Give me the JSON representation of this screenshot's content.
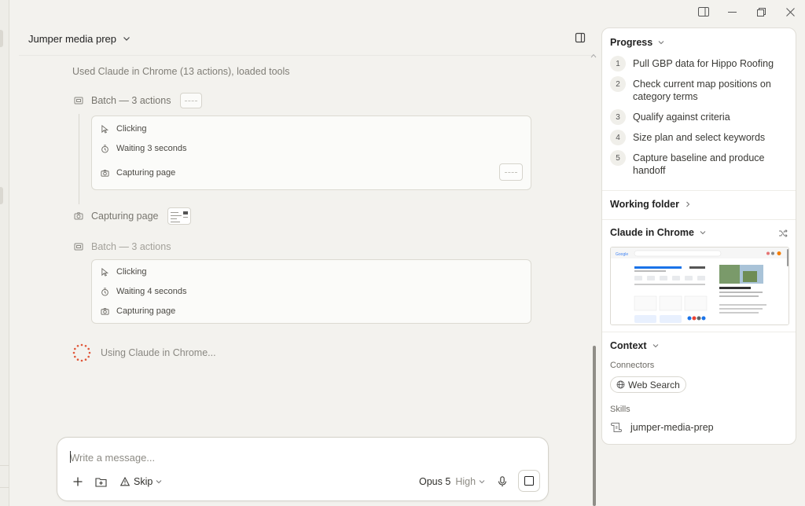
{
  "window": {
    "controls": [
      "sidebar-toggle-icon",
      "minimize-icon",
      "restore-icon",
      "close-icon"
    ]
  },
  "header": {
    "title": "Jumper media prep"
  },
  "transcript": {
    "used_line": "Used Claude in Chrome (13 actions), loaded tools",
    "batch1": {
      "label": "Batch — 3 actions",
      "steps": [
        "Clicking",
        "Waiting 3 seconds",
        "Capturing page"
      ]
    },
    "capture": {
      "label": "Capturing page"
    },
    "batch2": {
      "label": "Batch — 3 actions",
      "steps": [
        "Clicking",
        "Waiting 4 seconds",
        "Capturing page"
      ]
    },
    "status": "Using Claude in Chrome..."
  },
  "composer": {
    "placeholder": "Write a message...",
    "skip_label": "Skip",
    "model_label": "Opus 5",
    "effort_label": "High"
  },
  "panel": {
    "progress": {
      "title": "Progress",
      "items": [
        {
          "num": "1",
          "text": "Pull GBP data for Hippo Roofing"
        },
        {
          "num": "2",
          "text": "Check current map positions on category terms"
        },
        {
          "num": "3",
          "text": "Qualify against criteria"
        },
        {
          "num": "4",
          "text": "Size plan and select keywords"
        },
        {
          "num": "5",
          "text": "Capture baseline and produce handoff"
        }
      ]
    },
    "working_folder": "Working folder",
    "chrome": {
      "title": "Claude in Chrome"
    },
    "context": {
      "title": "Context",
      "connectors_label": "Connectors",
      "connector": "Web Search",
      "skills_label": "Skills",
      "skill": "jumper-media-prep"
    }
  },
  "colors": {
    "background": "#f3f2ee",
    "panel": "#ffffff",
    "spinner": "#e0573a",
    "text": "#2b2a27"
  }
}
